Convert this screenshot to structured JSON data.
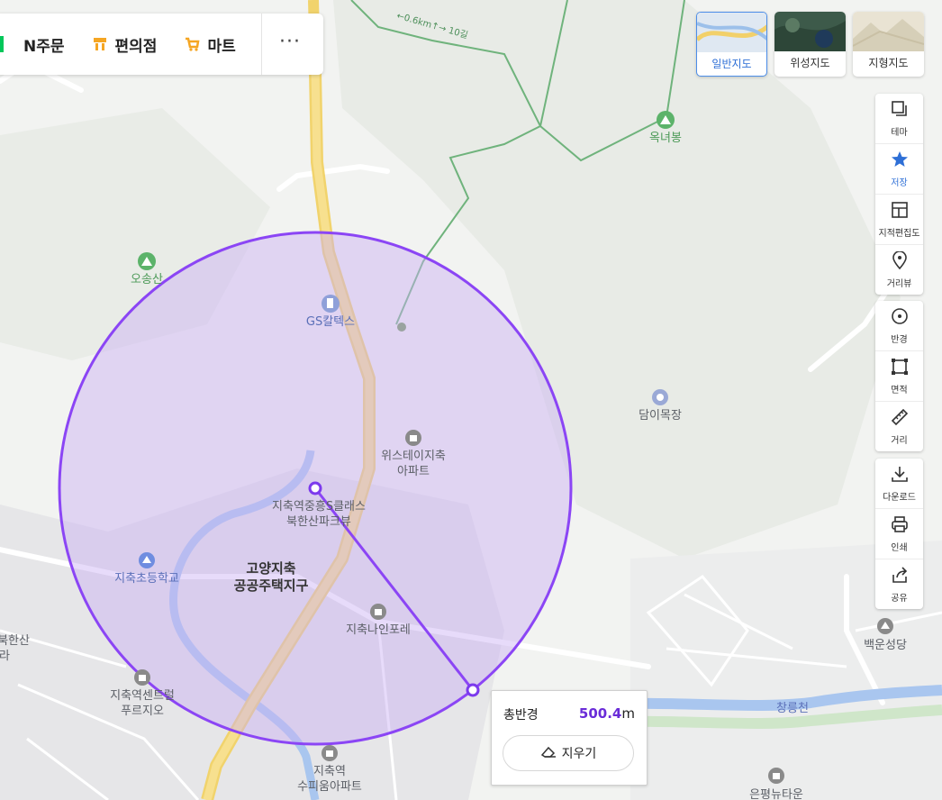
{
  "top_bar": {
    "items": [
      {
        "label": "N주문",
        "icon": "naver-order-icon",
        "color": "#03c75a"
      },
      {
        "label": "편의점",
        "icon": "convenience-store-icon",
        "color": "#f5a623"
      },
      {
        "label": "마트",
        "icon": "shopping-cart-icon",
        "color": "#f5a623"
      }
    ],
    "more_label": "···"
  },
  "map_types": [
    {
      "label": "일반지도",
      "active": true
    },
    {
      "label": "위성지도",
      "active": false
    },
    {
      "label": "지형지도",
      "active": false
    }
  ],
  "tools": {
    "group1": [
      {
        "label": "테마",
        "icon": "layers-icon"
      },
      {
        "label": "저장",
        "icon": "star-icon",
        "active": true
      },
      {
        "label": "지적편집도",
        "icon": "cadastral-map-icon"
      },
      {
        "label": "거리뷰",
        "icon": "street-view-icon"
      }
    ],
    "group2": [
      {
        "label": "반경",
        "icon": "radius-icon"
      },
      {
        "label": "면적",
        "icon": "area-icon"
      },
      {
        "label": "거리",
        "icon": "ruler-icon"
      }
    ],
    "group3": [
      {
        "label": "다운로드",
        "icon": "download-icon"
      },
      {
        "label": "인쇄",
        "icon": "print-icon"
      },
      {
        "label": "공유",
        "icon": "share-icon"
      }
    ]
  },
  "map_labels": {
    "oksongsan": "오송산",
    "oknyeobong": "옥녀봉",
    "gs_caltex": "GS칼텍스",
    "daminokjang": "담이목장",
    "wistay_1": "위스테이지축",
    "wistay_2": "아파트",
    "jichuk_class_1": "지축역중흥S클래스",
    "jichuk_class_2": "북한산파크뷰",
    "district_1": "고양지축",
    "district_2": "공공주택지구",
    "school": "지축초등학교",
    "nain": "지축나인포레",
    "center_1": "지축역센트럴",
    "center_2": "푸르지오",
    "supium_1": "지축역",
    "supium_2": "수피움아파트",
    "bukhansan_1": "북한산",
    "bukhansan_2": "라",
    "baekun": "백운성당",
    "changneungcheon": "창릉천",
    "eunpyeong": "은평뉴타운",
    "trail": "←0.6km↑→ 10길"
  },
  "measure": {
    "label": "총반경",
    "value": "500.4",
    "unit": "m",
    "clear_label": "지우기",
    "color": "#7c3aed"
  }
}
